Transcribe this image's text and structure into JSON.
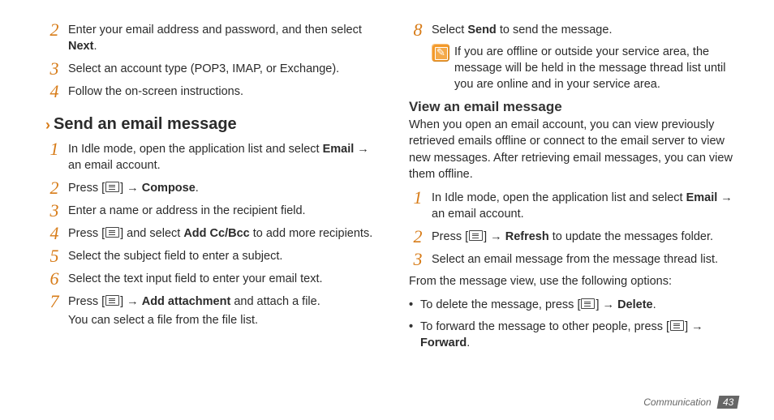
{
  "left": {
    "setup": [
      {
        "n": "2",
        "pre": "Enter your email address and password, and then select ",
        "bold": "Next",
        "post": "."
      },
      {
        "n": "3",
        "pre": "Select an account type (POP3, IMAP, or Exchange).",
        "bold": "",
        "post": ""
      },
      {
        "n": "4",
        "pre": "Follow the on-screen instructions.",
        "bold": "",
        "post": ""
      }
    ],
    "section_title": "Send an email message",
    "send": [
      {
        "n": "1",
        "pre": "In Idle mode, open the application list and select ",
        "bold": "Email",
        "post": " → an email account."
      },
      {
        "n": "2",
        "pre": "Press [",
        "icon": true,
        "mid": "] → ",
        "bold": "Compose",
        "post": "."
      },
      {
        "n": "3",
        "pre": "Enter a name or address in the recipient field.",
        "bold": "",
        "post": ""
      },
      {
        "n": "4",
        "pre": "Press [",
        "icon": true,
        "mid": "] and select ",
        "bold": "Add Cc/Bcc",
        "post": " to add more recipients."
      },
      {
        "n": "5",
        "pre": "Select the subject field to enter a subject.",
        "bold": "",
        "post": ""
      },
      {
        "n": "6",
        "pre": "Select the text input field to enter your email text.",
        "bold": "",
        "post": ""
      },
      {
        "n": "7",
        "pre": "Press [",
        "icon": true,
        "mid": "] → ",
        "bold": "Add attachment",
        "post": " and attach a file."
      }
    ],
    "send7_sub": "You can select a file from the file list."
  },
  "right": {
    "step8": {
      "n": "8",
      "pre": "Select ",
      "bold": "Send",
      "post": " to send the message."
    },
    "note": "If you are offline or outside your service area, the message will be held in the message thread list until you are online and in your service area.",
    "sub_title": "View an email message",
    "intro": "When you open an email account, you can view previously retrieved emails offline or connect to the email server to view new messages. After retrieving email messages, you can view them offline.",
    "view": [
      {
        "n": "1",
        "pre": "In Idle mode, open the application list and select ",
        "bold": "Email",
        "post": " → an email account."
      },
      {
        "n": "2",
        "pre": "Press [",
        "icon": true,
        "mid": "] → ",
        "bold": "Refresh",
        "post": " to update the messages folder."
      },
      {
        "n": "3",
        "pre": "Select an email message from the message thread list.",
        "bold": "",
        "post": ""
      }
    ],
    "options_lead": "From the message view, use the following options:",
    "options": [
      {
        "pre": "To delete the message, press [",
        "icon": true,
        "mid": "] → ",
        "bold": "Delete",
        "post": "."
      },
      {
        "pre": "To forward the message to other people, press [",
        "icon": true,
        "mid": "] → ",
        "bold": "Forward",
        "post": "."
      }
    ]
  },
  "footer": {
    "section": "Communication",
    "page": "43"
  }
}
